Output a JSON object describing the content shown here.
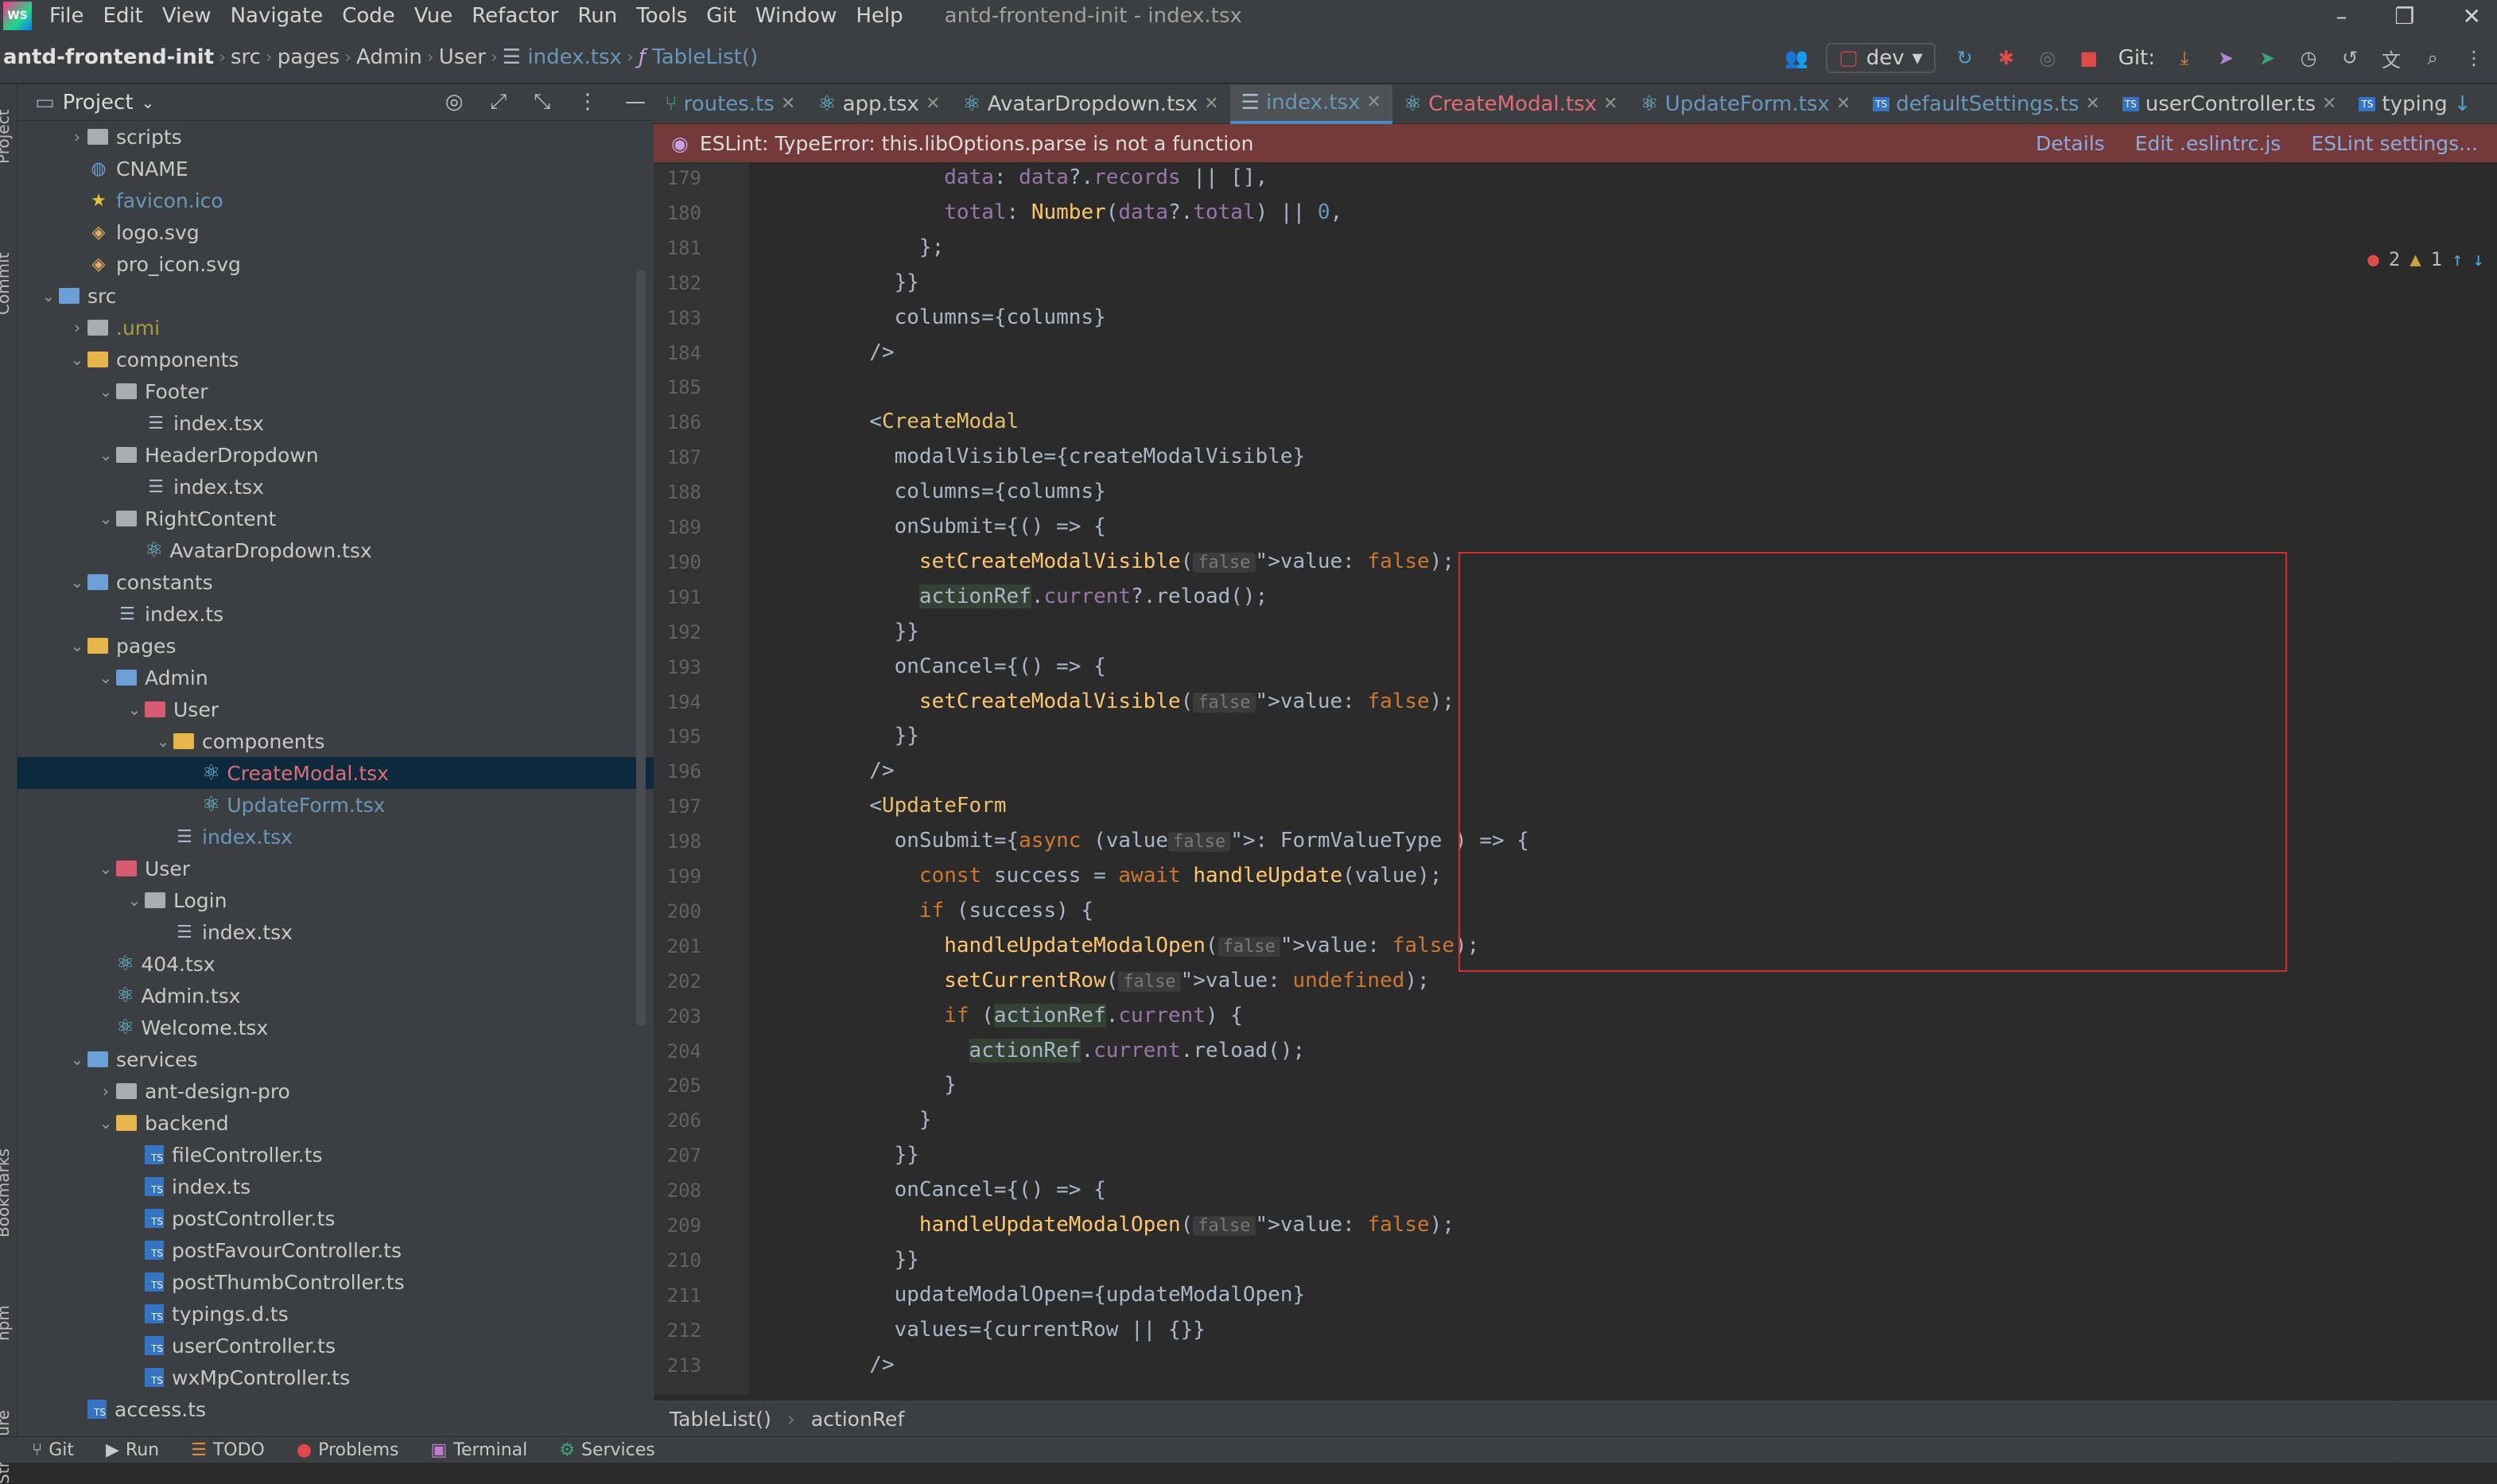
{
  "menubar": {
    "logo": "WS",
    "items": [
      "File",
      "Edit",
      "View",
      "Navigate",
      "Code",
      "Vue",
      "Refactor",
      "Run",
      "Tools",
      "Git",
      "Window",
      "Help"
    ],
    "title": "antd-frontend-init - index.tsx"
  },
  "breadcrumb": {
    "project": "antd-frontend-init",
    "parts": [
      "src",
      "pages",
      "Admin",
      "User"
    ],
    "file": "index.tsx",
    "symbol": "TableList()"
  },
  "toolbar": {
    "branch": "dev",
    "git_label": "Git:"
  },
  "project_panel": {
    "title": "Project",
    "tree": [
      {
        "label": "scripts",
        "depth": 2,
        "kind": "folder",
        "arrow": "›"
      },
      {
        "label": "CNAME",
        "depth": 2,
        "kind": "file-cname"
      },
      {
        "label": "favicon.ico",
        "depth": 2,
        "kind": "file-star"
      },
      {
        "label": "logo.svg",
        "depth": 2,
        "kind": "file-svg"
      },
      {
        "label": "pro_icon.svg",
        "depth": 2,
        "kind": "file-svg"
      },
      {
        "label": "src",
        "depth": 1,
        "kind": "folder-blue",
        "arrow": "⌄"
      },
      {
        "label": ".umi",
        "depth": 2,
        "kind": "folder",
        "arrow": "›"
      },
      {
        "label": "components",
        "depth": 2,
        "kind": "folder-yel",
        "arrow": "⌄"
      },
      {
        "label": "Footer",
        "depth": 3,
        "kind": "folder",
        "arrow": "⌄"
      },
      {
        "label": "index.tsx",
        "depth": 4,
        "kind": "file-tsx"
      },
      {
        "label": "HeaderDropdown",
        "depth": 3,
        "kind": "folder",
        "arrow": "⌄"
      },
      {
        "label": "index.tsx",
        "depth": 4,
        "kind": "file-tsx"
      },
      {
        "label": "RightContent",
        "depth": 3,
        "kind": "folder",
        "arrow": "⌄"
      },
      {
        "label": "AvatarDropdown.tsx",
        "depth": 4,
        "kind": "file-react"
      },
      {
        "label": "constants",
        "depth": 2,
        "kind": "folder-blue",
        "arrow": "⌄"
      },
      {
        "label": "index.ts",
        "depth": 3,
        "kind": "file-tsx"
      },
      {
        "label": "pages",
        "depth": 2,
        "kind": "folder-yel",
        "arrow": "⌄"
      },
      {
        "label": "Admin",
        "depth": 3,
        "kind": "folder-blue",
        "arrow": "⌄"
      },
      {
        "label": "User",
        "depth": 4,
        "kind": "folder-red",
        "arrow": "⌄"
      },
      {
        "label": "components",
        "depth": 5,
        "kind": "folder-yel",
        "arrow": "⌄"
      },
      {
        "label": "CreateModal.tsx",
        "depth": 6,
        "kind": "file-react",
        "selected": true
      },
      {
        "label": "UpdateForm.tsx",
        "depth": 6,
        "kind": "file-react"
      },
      {
        "label": "index.tsx",
        "depth": 5,
        "kind": "file-tsx"
      },
      {
        "label": "User",
        "depth": 3,
        "kind": "folder-red",
        "arrow": "⌄"
      },
      {
        "label": "Login",
        "depth": 4,
        "kind": "folder",
        "arrow": "⌄"
      },
      {
        "label": "index.tsx",
        "depth": 5,
        "kind": "file-tsx"
      },
      {
        "label": "404.tsx",
        "depth": 3,
        "kind": "file-react"
      },
      {
        "label": "Admin.tsx",
        "depth": 3,
        "kind": "file-react"
      },
      {
        "label": "Welcome.tsx",
        "depth": 3,
        "kind": "file-react"
      },
      {
        "label": "services",
        "depth": 2,
        "kind": "folder-blue",
        "arrow": "⌄"
      },
      {
        "label": "ant-design-pro",
        "depth": 3,
        "kind": "folder",
        "arrow": "›"
      },
      {
        "label": "backend",
        "depth": 3,
        "kind": "folder-yel",
        "arrow": "⌄"
      },
      {
        "label": "fileController.ts",
        "depth": 4,
        "kind": "file-ts"
      },
      {
        "label": "index.ts",
        "depth": 4,
        "kind": "file-ts"
      },
      {
        "label": "postController.ts",
        "depth": 4,
        "kind": "file-ts"
      },
      {
        "label": "postFavourController.ts",
        "depth": 4,
        "kind": "file-ts"
      },
      {
        "label": "postThumbController.ts",
        "depth": 4,
        "kind": "file-ts"
      },
      {
        "label": "typings.d.ts",
        "depth": 4,
        "kind": "file-ts"
      },
      {
        "label": "userController.ts",
        "depth": 4,
        "kind": "file-ts"
      },
      {
        "label": "wxMpController.ts",
        "depth": 4,
        "kind": "file-ts"
      },
      {
        "label": "access.ts",
        "depth": 2,
        "kind": "file-ts"
      }
    ]
  },
  "side_tools": [
    "Project",
    "Commit",
    "Bookmarks",
    "npm",
    "Structure"
  ],
  "tabs": [
    {
      "label": "routes.ts",
      "kind": "ts-green"
    },
    {
      "label": "app.tsx",
      "kind": "react"
    },
    {
      "label": "AvatarDropdown.tsx",
      "kind": "react"
    },
    {
      "label": "index.tsx",
      "kind": "tsx",
      "active": true
    },
    {
      "label": "CreateModal.tsx",
      "kind": "react",
      "modified": true
    },
    {
      "label": "UpdateForm.tsx",
      "kind": "react",
      "blue": true
    },
    {
      "label": "defaultSettings.ts",
      "kind": "ts",
      "blue": true
    },
    {
      "label": "userController.ts",
      "kind": "ts"
    },
    {
      "label": "typing",
      "kind": "ts"
    }
  ],
  "eslint_banner": {
    "message": "ESLint: TypeError: this.libOptions.parse is not a function",
    "links": [
      "Details",
      "Edit .eslintrc.js",
      "ESLint settings..."
    ]
  },
  "inspections": {
    "errors": "2",
    "warnings": "1"
  },
  "code": {
    "first_line": 179,
    "lines": [
      "        data: data?.records || [],",
      "        total: Number(data?.total) || 0,",
      "      };",
      "    }}",
      "    columns={columns}",
      "  />",
      "",
      "  <CreateModal",
      "    modalVisible={createModalVisible}",
      "    columns={columns}",
      "    onSubmit={() => {",
      "      setCreateModalVisible( value: false);",
      "      actionRef.current?.reload();",
      "    }}",
      "    onCancel={() => {",
      "      setCreateModalVisible( value: false);",
      "    }}",
      "  />",
      "  <UpdateForm",
      "    onSubmit={async (value : FormValueType ) => {",
      "      const success = await handleUpdate(value);",
      "      if (success) {",
      "        handleUpdateModalOpen( value: false);",
      "        setCurrentRow( value: undefined);",
      "        if (actionRef.current) {",
      "          actionRef.current.reload();",
      "        }",
      "      }",
      "    }}",
      "    onCancel={() => {",
      "      handleUpdateModalOpen( value: false);",
      "    }}",
      "    updateModalOpen={updateModalOpen}",
      "    values={currentRow || {}}",
      "  />"
    ]
  },
  "bottom_breadcrumb": [
    "TableList()",
    "actionRef"
  ],
  "statusbar": [
    "Git",
    "Run",
    "TODO",
    "Problems",
    "Terminal",
    "Services"
  ]
}
